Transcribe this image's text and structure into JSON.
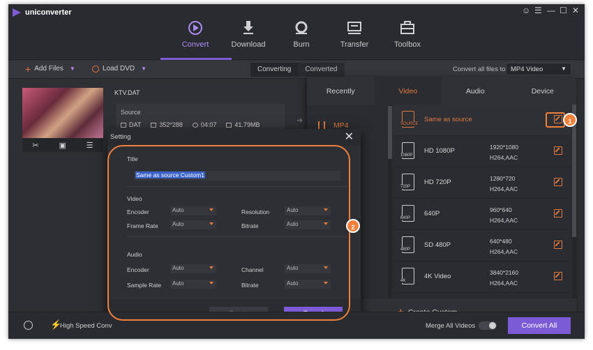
{
  "app": {
    "name": "uniconverter"
  },
  "window_controls": [
    "user-icon",
    "menu-icon",
    "minimize-icon",
    "maximize-icon",
    "close-icon"
  ],
  "nav": {
    "items": [
      {
        "label": "Convert",
        "icon": "convert-icon",
        "active": true
      },
      {
        "label": "Download",
        "icon": "download-icon",
        "active": false
      },
      {
        "label": "Burn",
        "icon": "burn-icon",
        "active": false
      },
      {
        "label": "Transfer",
        "icon": "transfer-icon",
        "active": false
      },
      {
        "label": "Toolbox",
        "icon": "toolbox-icon",
        "active": false
      }
    ]
  },
  "toolbar": {
    "add_files": "Add Files",
    "load_dvd": "Load DVD",
    "tab_converting": "Converting",
    "tab_converted": "Converted",
    "convert_all_label": "Convert all files to:",
    "convert_all_value": "MP4 Video"
  },
  "file": {
    "name": "KTV.DAT",
    "source_label": "Source",
    "format": "DAT",
    "resolution": "352*288",
    "duration": "04:07",
    "size": "41.79MB"
  },
  "format_popup": {
    "tabs": [
      "Recently",
      "Video",
      "Audio",
      "Device"
    ],
    "active_tab": "Video",
    "selected_format": "MP4",
    "presets": [
      {
        "name": "Same as source",
        "icon_label": "SOURCE",
        "res": "",
        "codec": ""
      },
      {
        "name": "HD 1080P",
        "icon_label": "1080P",
        "res": "1920*1080",
        "codec": "H264,AAC"
      },
      {
        "name": "HD 720P",
        "icon_label": "720P",
        "res": "1280*720",
        "codec": "H264,AAC"
      },
      {
        "name": "640P",
        "icon_label": "640P",
        "res": "960*640",
        "codec": "H264,AAC"
      },
      {
        "name": "SD 480P",
        "icon_label": "480P",
        "res": "640*480",
        "codec": "H264,AAC"
      },
      {
        "name": "4K Video",
        "icon_label": "4K",
        "res": "3840*2160",
        "codec": "H264,AAC"
      }
    ],
    "create_custom": "Create Custom"
  },
  "callouts": {
    "one": "1",
    "two": "2"
  },
  "setting_dialog": {
    "title": "Setting",
    "title_label": "Title",
    "title_value": "Same as source Custom1",
    "video_header": "Video",
    "audio_header": "Audio",
    "encoder_label": "Encoder",
    "resolution_label": "Resolution",
    "frame_rate_label": "Frame Rate",
    "bitrate_label": "Bitrate",
    "channel_label": "Channel",
    "sample_rate_label": "Sample Rate",
    "auto": "Auto",
    "create_button": "Create",
    "cancel_button": "Cancel"
  },
  "bottom": {
    "high_speed": "High Speed Conv",
    "merge_all": "Merge All Videos",
    "convert_all_button": "Convert All"
  },
  "colors": {
    "accent": "#7b5cd6",
    "highlight": "#e07a3f",
    "callout": "#f0803c"
  }
}
